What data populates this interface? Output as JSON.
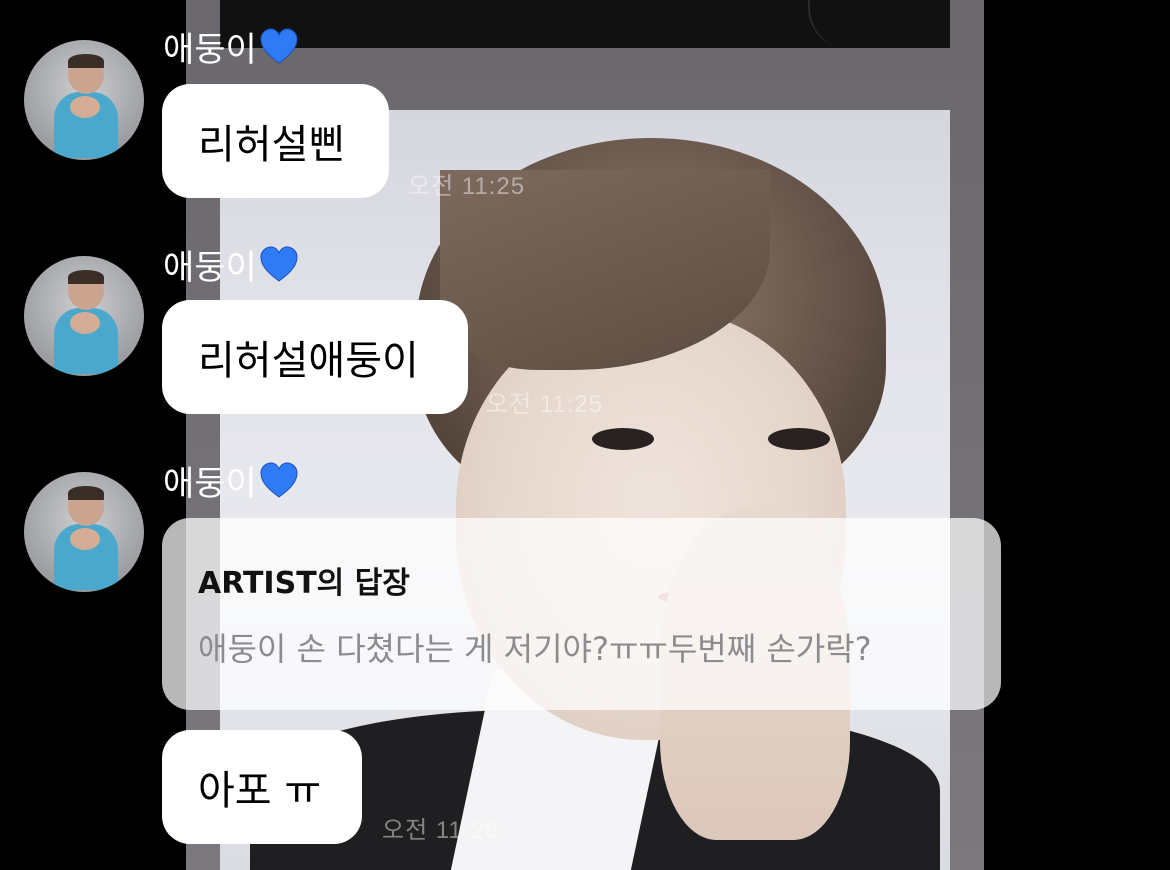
{
  "messages": [
    {
      "sender": "애둥이",
      "text": "리허설삔",
      "time": "오전 11:25"
    },
    {
      "sender": "애둥이",
      "text": "리허설애둥이",
      "time": "오전 11:25"
    },
    {
      "sender": "애둥이",
      "reply": {
        "title": "ARTIST의 답장",
        "quote": "애둥이 손 다쳤다는 게 저기야?ㅠㅠ두번째 손가락?"
      },
      "text": "아포 ㅠ",
      "time": "오전 11:28"
    }
  ],
  "icons": {
    "heart": "blue-heart-icon",
    "avatar": "profile-avatar"
  },
  "colors": {
    "background": "#000000",
    "bubble": "#ffffff",
    "heart": "#2f7bf5",
    "quote_text": "#8c8c8f"
  }
}
